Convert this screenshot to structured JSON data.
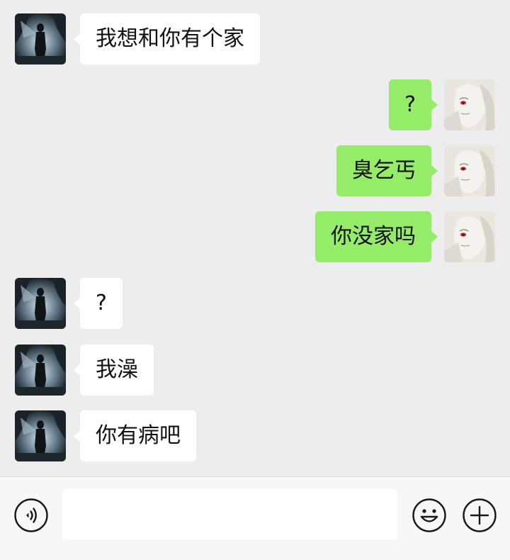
{
  "messages": [
    {
      "side": "left",
      "avatar": "dark-figure-avatar",
      "text": "我想和你有个家"
    },
    {
      "side": "right",
      "avatar": "pale-face-avatar",
      "text": "?"
    },
    {
      "side": "right",
      "avatar": "pale-face-avatar",
      "text": "臭乞丐"
    },
    {
      "side": "right",
      "avatar": "pale-face-avatar",
      "text": "你没家吗"
    },
    {
      "side": "left",
      "avatar": "dark-figure-avatar",
      "text": "?"
    },
    {
      "side": "left",
      "avatar": "dark-figure-avatar",
      "text": "我澡"
    },
    {
      "side": "left",
      "avatar": "dark-figure-avatar",
      "text": "你有病吧"
    }
  ],
  "input_bar": {
    "voice_icon": "voice-icon",
    "input_value": "",
    "emoji_icon": "emoji-icon",
    "plus_icon": "plus-icon"
  },
  "colors": {
    "background": "#ededed",
    "incoming_bubble": "#ffffff",
    "outgoing_bubble": "#95ec69",
    "input_bar": "#f7f7f7"
  }
}
